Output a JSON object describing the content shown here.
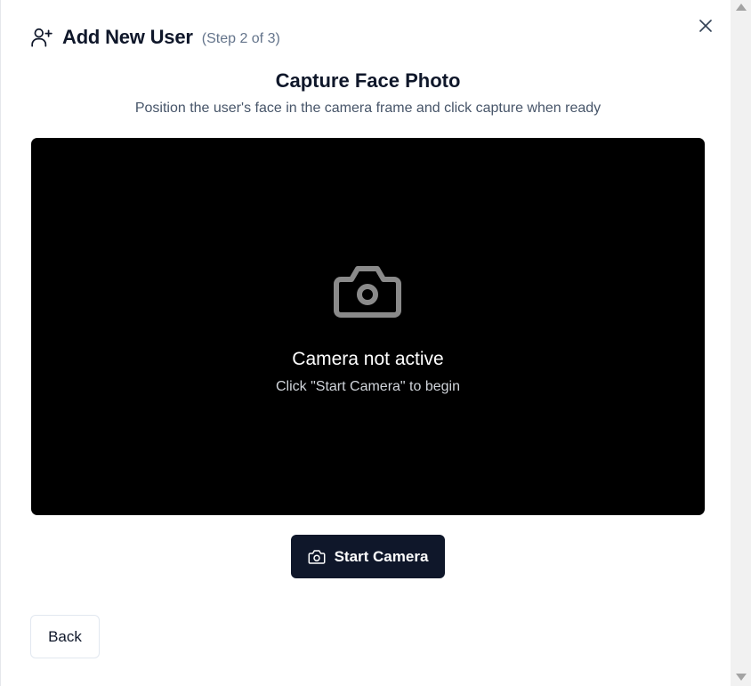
{
  "dialog": {
    "title": "Add New User",
    "step": "(Step 2 of 3)",
    "close_icon": "close-icon",
    "header_icon": "user-plus-icon"
  },
  "capture": {
    "title": "Capture Face Photo",
    "subtitle": "Position the user's face in the camera frame and click capture when ready"
  },
  "camera": {
    "icon": "camera-icon",
    "status": "Camera not active",
    "hint": "Click \"Start Camera\" to begin",
    "background_color": "#000000"
  },
  "actions": {
    "start_camera_label": "Start Camera",
    "back_label": "Back",
    "primary_color": "#0f172a"
  }
}
